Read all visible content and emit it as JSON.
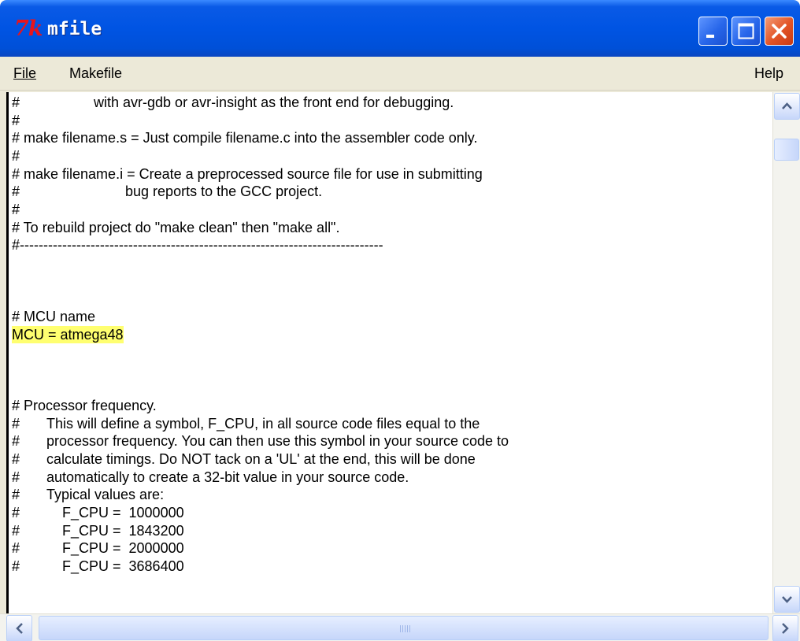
{
  "window": {
    "title": "mfile",
    "app_icon_text": "7k",
    "accent_color": "#0054e3",
    "controls": {
      "minimize": "minimize-icon",
      "maximize": "maximize-icon",
      "close": "close-icon"
    }
  },
  "menu": {
    "file": "File",
    "makefile": "Makefile",
    "help": "Help"
  },
  "editor": {
    "highlight_color": "#ffff70",
    "lines": [
      {
        "hash": "#",
        "text": "            with avr-gdb or avr-insight as the front end for debugging."
      },
      {
        "hash": "#",
        "text": ""
      },
      {
        "hash": "",
        "text": "# make filename.s = Just compile filename.c into the assembler code only."
      },
      {
        "hash": "#",
        "text": ""
      },
      {
        "hash": "",
        "text": "# make filename.i = Create a preprocessed source file for use in submitting"
      },
      {
        "hash": "#",
        "text": "                    bug reports to the GCC project."
      },
      {
        "hash": "#",
        "text": ""
      },
      {
        "hash": "",
        "text": "# To rebuild project do \"make clean\" then \"make all\"."
      },
      {
        "hash": "",
        "text": "#-----------------------------------------------------------------------------"
      },
      {
        "hash": "",
        "text": ""
      },
      {
        "hash": "",
        "text": ""
      },
      {
        "hash": "",
        "text": ""
      },
      {
        "hash": "",
        "text": "# MCU name"
      },
      {
        "hash": "",
        "text": "MCU = atmega48",
        "highlight": true
      },
      {
        "hash": "",
        "text": ""
      },
      {
        "hash": "",
        "text": ""
      },
      {
        "hash": "",
        "text": ""
      },
      {
        "hash": "",
        "text": "# Processor frequency."
      },
      {
        "hash": "#",
        "text": "This will define a symbol, F_CPU, in all source code files equal to the"
      },
      {
        "hash": "#",
        "text": "processor frequency. You can then use this symbol in your source code to"
      },
      {
        "hash": "#",
        "text": "calculate timings. Do NOT tack on a 'UL' at the end, this will be done"
      },
      {
        "hash": "#",
        "text": "automatically to create a 32-bit value in your source code."
      },
      {
        "hash": "#",
        "text": "Typical values are:"
      },
      {
        "hash": "#",
        "text": "    F_CPU =  1000000"
      },
      {
        "hash": "#",
        "text": "    F_CPU =  1843200"
      },
      {
        "hash": "#",
        "text": "    F_CPU =  2000000"
      },
      {
        "hash": "#",
        "text": "    F_CPU =  3686400"
      }
    ]
  },
  "scrollbars": {
    "vertical": {
      "up": "scroll-up-icon",
      "down": "scroll-down-icon",
      "position": 0.1
    },
    "horizontal": {
      "left": "scroll-left-icon",
      "right": "scroll-right-icon"
    }
  }
}
